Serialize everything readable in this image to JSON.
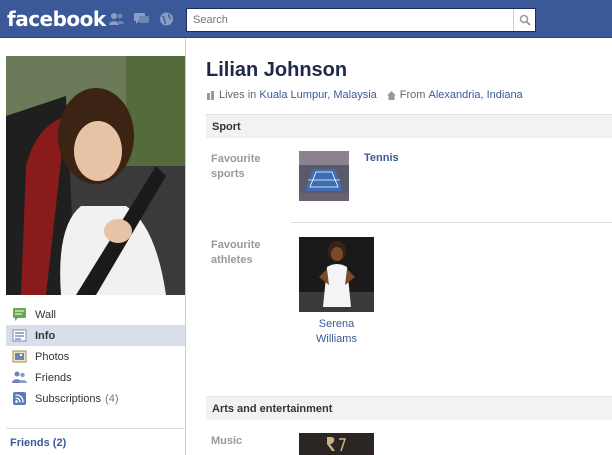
{
  "topbar": {
    "logo": "facebook",
    "search_placeholder": "Search"
  },
  "profile": {
    "name": "Lilian Johnson",
    "lives_prefix": "Lives in",
    "lives_in": "Kuala Lumpur, Malaysia",
    "from_prefix": "From",
    "from": "Alexandria, Indiana"
  },
  "sidebar": {
    "items": [
      {
        "label": "Wall",
        "icon": "wall-icon"
      },
      {
        "label": "Info",
        "icon": "info-icon",
        "active": true
      },
      {
        "label": "Photos",
        "icon": "photos-icon"
      },
      {
        "label": "Friends",
        "icon": "friends-icon"
      },
      {
        "label": "Subscriptions",
        "icon": "subscriptions-icon",
        "count": "(4)"
      }
    ],
    "friends_heading": "Friends (2)"
  },
  "sections": {
    "sport": {
      "title": "Sport",
      "fav_sports_label": "Favourite sports",
      "fav_sports_item": "Tennis",
      "fav_athletes_label": "Favourite athletes",
      "fav_athletes_item": "Serena Williams"
    },
    "arts": {
      "title": "Arts and entertainment",
      "music_label": "Music"
    }
  },
  "colors": {
    "brand": "#3b5998",
    "header_border": "#29447e",
    "active_nav": "#d8dfea"
  }
}
